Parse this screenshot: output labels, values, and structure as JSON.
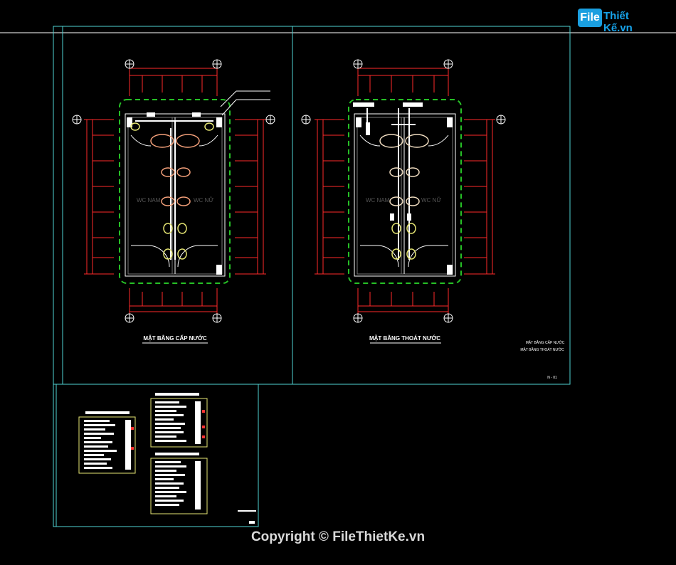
{
  "colors": {
    "background": "#000000",
    "frame": "#4fd3d3",
    "dimension": "#ff2a2a",
    "green_boundary": "#26c026",
    "wall": "#ffffff",
    "fixture": "#f4a07a",
    "yellow": "#e6e673"
  },
  "watermark": {
    "logo_box": "File",
    "logo_rest": "Thiết Kế.vn"
  },
  "sheets": {
    "left_plan_title": "MẶT BẰNG CẤP NƯỚC",
    "right_plan_title": "MẶT BẰNG THOÁT NƯỚC",
    "left_room_labels": [
      "WC NAM",
      "WC NỮ"
    ],
    "right_room_labels": [
      "WC NAM",
      "WC NỮ"
    ],
    "title_block": [
      "MẶT BẰNG CẤP NƯỚC",
      "MẶT BẰNG THOÁT NƯỚC"
    ],
    "sheet_number": "N - 01"
  },
  "copyright": "Copyright © FileThietKe.vn"
}
